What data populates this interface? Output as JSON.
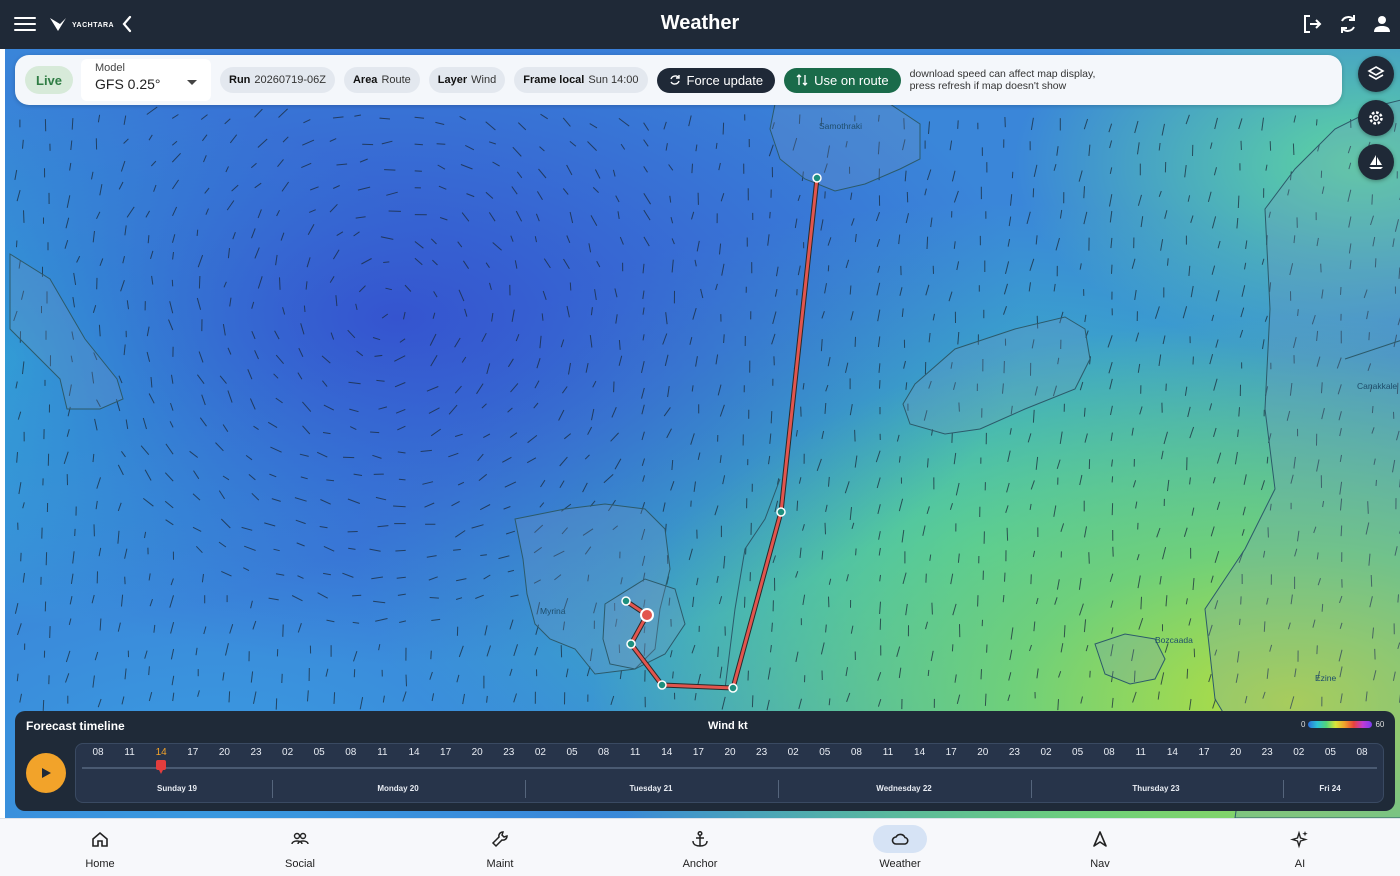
{
  "header": {
    "title": "Weather",
    "logo_text": "YACHTARA"
  },
  "controls": {
    "live_label": "Live",
    "model_label": "Model",
    "model_value": "GFS 0.25°",
    "run_label": "Run",
    "run_value": "20260719-06Z",
    "area_label": "Area",
    "area_value": "Route",
    "layer_label": "Layer",
    "layer_value": "Wind",
    "frame_label": "Frame local",
    "frame_value": "Sun 14:00",
    "force_update_label": "Force update",
    "use_on_route_label": "Use on route",
    "hint_line1": "download speed can affect map display,",
    "hint_line2": "press refresh if map doesn't show"
  },
  "map": {
    "place_labels": [
      "Samothraki",
      "Myrina",
      "Canakkale",
      "Ezine",
      "Bozcaada"
    ],
    "route_color": "#e2554e",
    "waypoint_color": "#1d8f7e"
  },
  "forecast": {
    "title": "Forecast timeline",
    "wind_label": "Wind kt",
    "legend_min": "0",
    "legend_max": "60",
    "hours": [
      "08",
      "11",
      "14",
      "17",
      "20",
      "23",
      "02",
      "05",
      "08",
      "11",
      "14",
      "17",
      "20",
      "23",
      "02",
      "05",
      "08",
      "11",
      "14",
      "17",
      "20",
      "23",
      "02",
      "05",
      "08",
      "11",
      "14",
      "17",
      "20",
      "23",
      "02",
      "05",
      "08",
      "11",
      "14",
      "17",
      "20",
      "23",
      "02",
      "05",
      "08"
    ],
    "active_hour_index": 2,
    "days": [
      "Sunday 19",
      "Monday 20",
      "Tuesday 21",
      "Wednesday 22",
      "Thursday 23",
      "Fri 24"
    ]
  },
  "nav": {
    "items": [
      {
        "label": "Home",
        "icon": "home-icon"
      },
      {
        "label": "Social",
        "icon": "social-icon"
      },
      {
        "label": "Maint",
        "icon": "wrench-icon"
      },
      {
        "label": "Anchor",
        "icon": "anchor-icon"
      },
      {
        "label": "Weather",
        "icon": "cloud-icon"
      },
      {
        "label": "Nav",
        "icon": "navigation-icon"
      },
      {
        "label": "AI",
        "icon": "sparkle-icon"
      }
    ],
    "active_index": 4
  },
  "colors": {
    "topbar": "#1f2937",
    "accent": "#f2a32a",
    "route_button": "#1a6b4a"
  }
}
